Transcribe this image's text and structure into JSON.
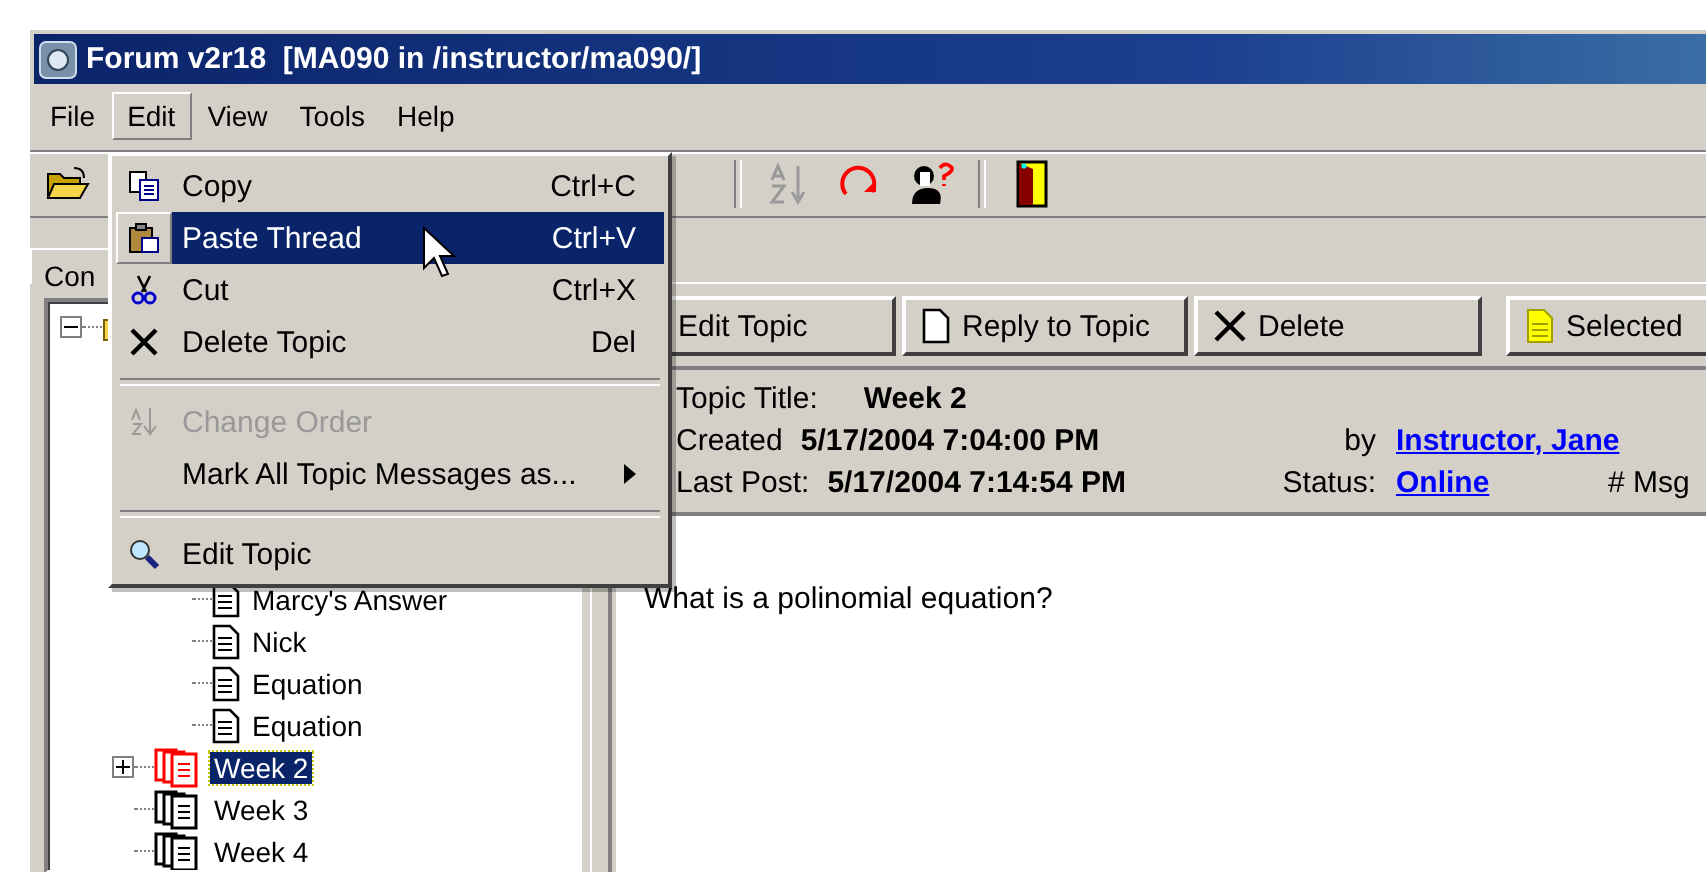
{
  "window": {
    "title": "Forum v2r18  [MA090 in /instructor/ma090/]"
  },
  "menu_bar": [
    {
      "label": "File",
      "selected": false
    },
    {
      "label": "Edit",
      "selected": true
    },
    {
      "label": "View",
      "selected": false
    },
    {
      "label": "Tools",
      "selected": false
    },
    {
      "label": "Help",
      "selected": false
    }
  ],
  "edit_menu": [
    {
      "kind": "command",
      "label": "Copy",
      "shortcut": "Ctrl+C",
      "selected": false,
      "disabled": false
    },
    {
      "kind": "command",
      "label": "Paste Thread",
      "shortcut": "Ctrl+V",
      "selected": true,
      "disabled": false
    },
    {
      "kind": "command",
      "label": "Cut",
      "shortcut": "Ctrl+X",
      "selected": false,
      "disabled": false
    },
    {
      "kind": "command",
      "label": "Delete Topic",
      "shortcut": "Del",
      "selected": false,
      "disabled": false
    },
    {
      "kind": "separator"
    },
    {
      "kind": "command",
      "label": "Change Order",
      "selected": false,
      "disabled": true
    },
    {
      "kind": "submenu",
      "label": "Mark All Topic Messages as...",
      "selected": false,
      "disabled": false
    },
    {
      "kind": "separator"
    },
    {
      "kind": "command",
      "label": "Edit Topic",
      "selected": false,
      "disabled": false
    }
  ],
  "tabs": [
    {
      "label": "Con",
      "selected": true
    }
  ],
  "tree": [
    {
      "kind": "forum",
      "expanded": true,
      "children": [
        {
          "kind": "topic",
          "children": [
            {
              "kind": "message",
              "label": "Marcy's Answer"
            },
            {
              "kind": "message",
              "label": "Nick"
            },
            {
              "kind": "message",
              "label": "Equation"
            },
            {
              "kind": "message",
              "label": "Equation"
            }
          ]
        },
        {
          "kind": "topic",
          "label": "Week 2",
          "expanded": false,
          "selected": true,
          "unread": true
        },
        {
          "kind": "topic",
          "label": "Week 3",
          "selected": false,
          "unread": false
        },
        {
          "kind": "topic",
          "label": "Week 4",
          "selected": false,
          "unread": false
        }
      ]
    }
  ],
  "topic_buttons": [
    {
      "label": "Edit Topic"
    },
    {
      "label": "Reply to Topic"
    },
    {
      "label": "Delete"
    },
    {
      "label": "Selected"
    }
  ],
  "topic_info": {
    "title_label": "Topic Title:",
    "title": "Week 2",
    "created_label": "Created",
    "created": "5/17/2004 7:04:00 PM",
    "by_label": "by",
    "author": "Instructor, Jane",
    "last_post_label": "Last Post:",
    "last_post": "5/17/2004 7:14:54 PM",
    "status_label": "Status:",
    "status": "Online",
    "msgs_label": "# Msg"
  },
  "message": {
    "body": "What is a polinomial equation?"
  }
}
